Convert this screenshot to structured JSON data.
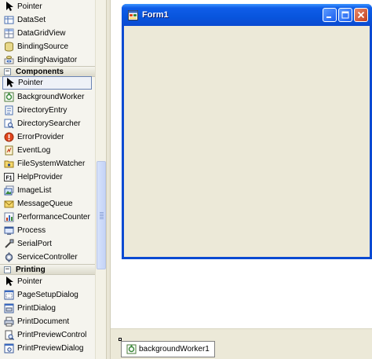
{
  "toolbox": {
    "top_items": [
      {
        "label": "Pointer",
        "icon": "pointer-icon"
      },
      {
        "label": "DataSet",
        "icon": "dataset-icon"
      },
      {
        "label": "DataGridView",
        "icon": "datagridview-icon"
      },
      {
        "label": "BindingSource",
        "icon": "bindingsource-icon"
      },
      {
        "label": "BindingNavigator",
        "icon": "bindingnavigator-icon"
      }
    ],
    "components_header": {
      "label": "Components",
      "toggle": "−"
    },
    "components_items": [
      {
        "label": "Pointer",
        "icon": "pointer-icon"
      },
      {
        "label": "BackgroundWorker",
        "icon": "backgroundworker-icon"
      },
      {
        "label": "DirectoryEntry",
        "icon": "directoryentry-icon"
      },
      {
        "label": "DirectorySearcher",
        "icon": "directorysearcher-icon"
      },
      {
        "label": "ErrorProvider",
        "icon": "errorprovider-icon"
      },
      {
        "label": "EventLog",
        "icon": "eventlog-icon"
      },
      {
        "label": "FileSystemWatcher",
        "icon": "filesystemwatcher-icon"
      },
      {
        "label": "HelpProvider",
        "icon": "helpprovider-icon"
      },
      {
        "label": "ImageList",
        "icon": "imagelist-icon"
      },
      {
        "label": "MessageQueue",
        "icon": "messagequeue-icon"
      },
      {
        "label": "PerformanceCounter",
        "icon": "performancecounter-icon"
      },
      {
        "label": "Process",
        "icon": "process-icon"
      },
      {
        "label": "SerialPort",
        "icon": "serialport-icon"
      },
      {
        "label": "ServiceController",
        "icon": "servicecontroller-icon"
      }
    ],
    "printing_header": {
      "label": "Printing",
      "toggle": "−"
    },
    "printing_items": [
      {
        "label": "Pointer",
        "icon": "pointer-icon"
      },
      {
        "label": "PageSetupDialog",
        "icon": "pagesetupdialog-icon"
      },
      {
        "label": "PrintDialog",
        "icon": "printdialog-icon"
      },
      {
        "label": "PrintDocument",
        "icon": "printdocument-icon"
      },
      {
        "label": "PrintPreviewControl",
        "icon": "printpreviewcontrol-icon"
      },
      {
        "label": "PrintPreviewDialog",
        "icon": "printpreviewdialog-icon"
      }
    ],
    "help_provider_badge": "F1"
  },
  "form": {
    "title": "Form1"
  },
  "tray": {
    "component_label": "backgroundWorker1"
  },
  "colors": {
    "titlebar": "#0855dd",
    "form_client": "#ece9d8",
    "toolbox_bg": "#f5f4ee",
    "selection_border": "#6a83b4"
  }
}
